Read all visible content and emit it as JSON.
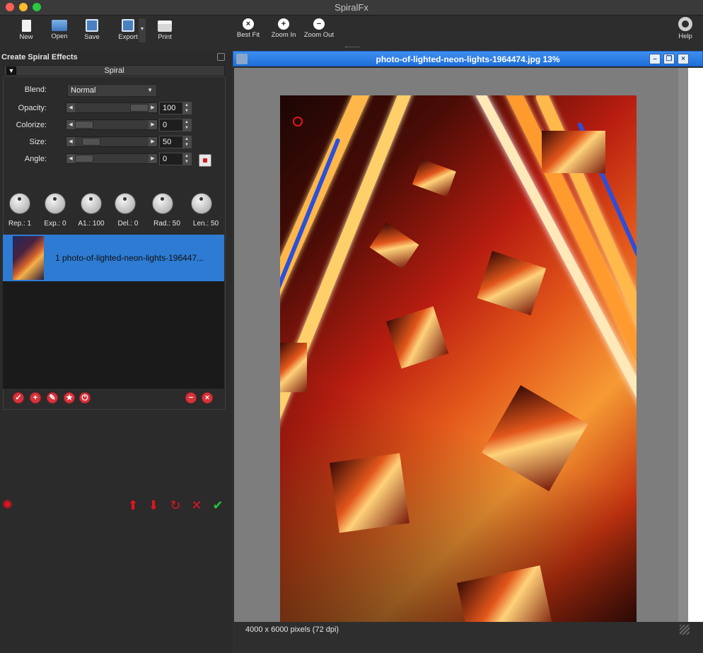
{
  "app": {
    "title": "SpiralFx"
  },
  "toolbar": {
    "new": "New",
    "open": "Open",
    "save": "Save",
    "export": "Export",
    "print": "Print",
    "best_fit": "Best Fit",
    "zoom_in": "Zoom In",
    "zoom_out": "Zoom Out",
    "help": "Help"
  },
  "panel": {
    "title": "Create Spiral Effects",
    "section": "Spiral",
    "blend": {
      "label": "Blend:",
      "value": "Normal"
    },
    "sliders": [
      {
        "label": "Opacity:",
        "value": "100"
      },
      {
        "label": "Colorize:",
        "value": "0"
      },
      {
        "label": "Size:",
        "value": "50"
      },
      {
        "label": "Angle:",
        "value": "0"
      }
    ],
    "knobs": [
      {
        "label": "Rep.: 1"
      },
      {
        "label": "Exp.: 0"
      },
      {
        "label": "A1.: 100"
      },
      {
        "label": "Del.: 0"
      },
      {
        "label": "Rad.: 50"
      },
      {
        "label": "Len.: 50"
      }
    ],
    "layers": [
      {
        "name": "1 photo-of-lighted-neon-lights-196447..."
      }
    ]
  },
  "document": {
    "title": "photo-of-lighted-neon-lights-1964474.jpg 13%",
    "status": "4000 x 6000 pixels (72 dpi)"
  },
  "colors": {
    "accent": "#2d7bd3",
    "titlebar": "#1f6fda",
    "action_red": "#e2141f",
    "action_green": "#22c33a"
  }
}
